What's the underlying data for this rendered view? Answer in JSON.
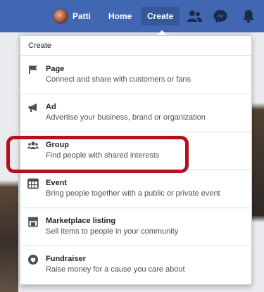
{
  "topbar": {
    "profile_name": "Patti",
    "home_label": "Home",
    "create_label": "Create",
    "icons": [
      "friends-icon",
      "messenger-icon",
      "notifications-bell-icon"
    ]
  },
  "dropdown": {
    "header": "Create",
    "items": [
      {
        "icon": "flag-icon",
        "title": "Page",
        "description": "Connect and share with customers or fans"
      },
      {
        "icon": "megaphone-icon",
        "title": "Ad",
        "description": "Advertise your business, brand or organization"
      },
      {
        "icon": "group-icon",
        "title": "Group",
        "description": "Find people with shared interests"
      },
      {
        "icon": "calendar-icon",
        "title": "Event",
        "description": "Bring people together with a public or private event"
      },
      {
        "icon": "storefront-icon",
        "title": "Marketplace listing",
        "description": "Sell items to people in your community"
      },
      {
        "icon": "fundraiser-icon",
        "title": "Fundraiser",
        "description": "Raise money for a cause you care about"
      }
    ]
  },
  "colors": {
    "topbar": "#4267b2",
    "create_active": "#365899",
    "highlight_outline": "#b3121b"
  }
}
